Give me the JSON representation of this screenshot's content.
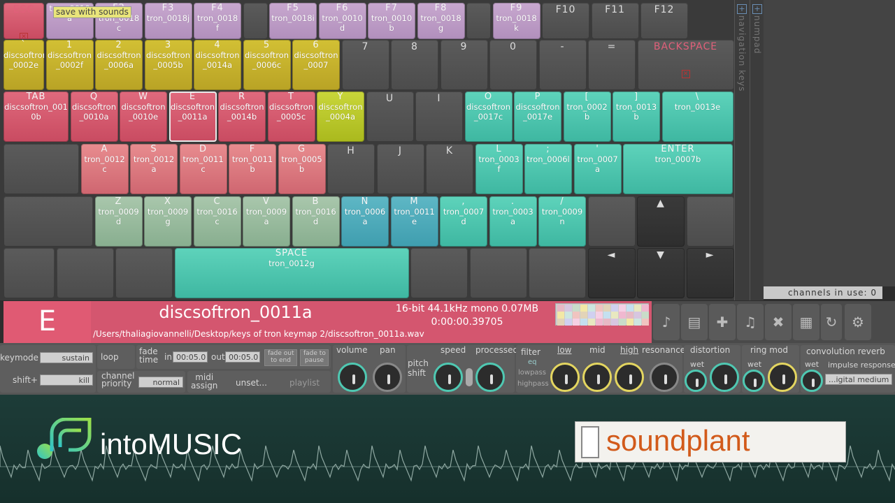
{
  "tooltip": "save with sounds",
  "keyboard": {
    "rows": [
      [
        {
          "label": "ESC",
          "sound": "",
          "color": "red",
          "esc": true
        },
        {
          "label": "",
          "sound": "tron_0010\na",
          "color": "lav"
        },
        {
          "label": "F2",
          "sound": "tron_0018\nc",
          "color": "lav"
        },
        {
          "label": "F3",
          "sound": "tron_0018j",
          "color": "lav"
        },
        {
          "label": "F4",
          "sound": "tron_0018\nf",
          "color": "lav"
        },
        {
          "label": "",
          "sound": "",
          "color": "grey"
        },
        {
          "label": "F5",
          "sound": "tron_0018i",
          "color": "lav"
        },
        {
          "label": "F6",
          "sound": "tron_0010\nd",
          "color": "lav"
        },
        {
          "label": "F7",
          "sound": "tron_0010\nb",
          "color": "lav"
        },
        {
          "label": "F8",
          "sound": "tron_0018\ng",
          "color": "lav"
        },
        {
          "label": "",
          "sound": "",
          "color": "grey"
        },
        {
          "label": "F9",
          "sound": "tron_0018\nk",
          "color": "lav"
        },
        {
          "label": "F10",
          "sound": "",
          "color": "grey"
        },
        {
          "label": "F11",
          "sound": "",
          "color": "grey"
        },
        {
          "label": "F12",
          "sound": "",
          "color": "grey"
        }
      ],
      [
        {
          "label": "`",
          "sound": "discsoftron\n_0002e",
          "color": "olive"
        },
        {
          "label": "1",
          "sound": "discsoftron\n_0002f",
          "color": "olive"
        },
        {
          "label": "2",
          "sound": "discsoftron\n_0006a",
          "color": "olive"
        },
        {
          "label": "3",
          "sound": "discsoftron\n_0005b",
          "color": "olive"
        },
        {
          "label": "4",
          "sound": "discsoftron\n_0014a",
          "color": "olive"
        },
        {
          "label": "5",
          "sound": "discsoftron\n_0006c",
          "color": "olive"
        },
        {
          "label": "6",
          "sound": "discsoftron\n_0007",
          "color": "olive"
        },
        {
          "label": "7",
          "sound": "",
          "color": "grey"
        },
        {
          "label": "8",
          "sound": "",
          "color": "grey"
        },
        {
          "label": "9",
          "sound": "",
          "color": "grey"
        },
        {
          "label": "0",
          "sound": "",
          "color": "grey"
        },
        {
          "label": "-",
          "sound": "",
          "color": "grey"
        },
        {
          "label": "=",
          "sound": "",
          "color": "grey"
        },
        {
          "label": "BACKSPACE",
          "sound": "",
          "color": "grey",
          "bs": true
        }
      ],
      [
        {
          "label": "TAB",
          "sound": "discsoftron_001\n0b",
          "color": "red"
        },
        {
          "label": "Q",
          "sound": "discsoftron\n_0010a",
          "color": "red"
        },
        {
          "label": "W",
          "sound": "discsoftron\n_0010e",
          "color": "red"
        },
        {
          "label": "E",
          "sound": "discsoftron\n_0011a",
          "color": "red",
          "sel": true
        },
        {
          "label": "R",
          "sound": "discsoftron\n_0014b",
          "color": "red"
        },
        {
          "label": "T",
          "sound": "discsoftron\n_0005c",
          "color": "red"
        },
        {
          "label": "Y",
          "sound": "discsoftron\n_0004a",
          "color": "lime"
        },
        {
          "label": "U",
          "sound": "",
          "color": "grey"
        },
        {
          "label": "I",
          "sound": "",
          "color": "grey"
        },
        {
          "label": "O",
          "sound": "discsoftron\n_0017c",
          "color": "teal"
        },
        {
          "label": "P",
          "sound": "discsoftron\n_0017e",
          "color": "teal"
        },
        {
          "label": "[",
          "sound": "tron_0002\nb",
          "color": "teal"
        },
        {
          "label": "]",
          "sound": "tron_0013\nb",
          "color": "teal"
        },
        {
          "label": "\\",
          "sound": "tron_0013e",
          "color": "teal"
        }
      ],
      [
        {
          "label": "",
          "sound": "",
          "color": "grey"
        },
        {
          "label": "A",
          "sound": "tron_0012\nc",
          "color": "rose"
        },
        {
          "label": "S",
          "sound": "tron_0012\na",
          "color": "rose"
        },
        {
          "label": "D",
          "sound": "tron_0011\nc",
          "color": "rose"
        },
        {
          "label": "F",
          "sound": "tron_0011\nb",
          "color": "rose"
        },
        {
          "label": "G",
          "sound": "tron_0005\nb",
          "color": "rose"
        },
        {
          "label": "H",
          "sound": "",
          "color": "grey"
        },
        {
          "label": "J",
          "sound": "",
          "color": "grey"
        },
        {
          "label": "K",
          "sound": "",
          "color": "grey"
        },
        {
          "label": "L",
          "sound": "tron_0003\nf",
          "color": "teal"
        },
        {
          "label": ";",
          "sound": "tron_0006l",
          "color": "teal"
        },
        {
          "label": "'",
          "sound": "tron_0007\na",
          "color": "teal"
        },
        {
          "label": "ENTER",
          "sound": "tron_0007b",
          "color": "teal"
        }
      ],
      [
        {
          "label": "",
          "sound": "",
          "color": "grey"
        },
        {
          "label": "Z",
          "sound": "tron_0009\nd",
          "color": "sage"
        },
        {
          "label": "X",
          "sound": "tron_0009\ng",
          "color": "sage"
        },
        {
          "label": "C",
          "sound": "tron_0016\nc",
          "color": "sage"
        },
        {
          "label": "V",
          "sound": "tron_0009\na",
          "color": "sage"
        },
        {
          "label": "B",
          "sound": "tron_0016\nd",
          "color": "sage"
        },
        {
          "label": "N",
          "sound": "tron_0006\na",
          "color": "cyan"
        },
        {
          "label": "M",
          "sound": "tron_0011\ne",
          "color": "cyan"
        },
        {
          "label": ",",
          "sound": "tron_0007\nd",
          "color": "teal"
        },
        {
          "label": ".",
          "sound": "tron_0003\na",
          "color": "teal"
        },
        {
          "label": "/",
          "sound": "tron_0009\nn",
          "color": "teal"
        },
        {
          "label": "",
          "sound": "",
          "color": "grey"
        },
        {
          "label": "▲",
          "sound": "",
          "color": "dark"
        },
        {
          "label": "",
          "sound": "",
          "color": "grey"
        }
      ],
      [
        {
          "label": "",
          "sound": "",
          "color": "grey"
        },
        {
          "label": "",
          "sound": "",
          "color": "grey"
        },
        {
          "label": "",
          "sound": "",
          "color": "grey"
        },
        {
          "label": "SPACE",
          "sound": "tron_0012g",
          "color": "teal"
        },
        {
          "label": "",
          "sound": "",
          "color": "grey"
        },
        {
          "label": "",
          "sound": "",
          "color": "grey"
        },
        {
          "label": "",
          "sound": "",
          "color": "grey"
        },
        {
          "label": "◄",
          "sound": "",
          "color": "dark"
        },
        {
          "label": "▼",
          "sound": "",
          "color": "dark"
        },
        {
          "label": "►",
          "sound": "",
          "color": "dark"
        }
      ]
    ]
  },
  "side": {
    "nav_label": "navigation keys",
    "numpad_label": "numpad",
    "channels": "channels in use:  0"
  },
  "sound": {
    "key": "E",
    "name": "discsoftron_0011a",
    "path": "/Users/thaliagiovannelli/Desktop/keys of tron keymap 2/discsoftron_0011a.wav",
    "format": "16-bit 44.1kHz mono 0.07MB",
    "time": "0:00:00.39705"
  },
  "controls": {
    "keymode": "keymode",
    "keymode_val": "sustain",
    "shift": "shift+",
    "shift_val": "kill",
    "loop": "loop",
    "channel_priority": "channel\npriority",
    "priority_val": "normal",
    "fade_time": "fade\ntime",
    "fade_in": "in",
    "fade_in_val": "00:05.0",
    "fade_out": "out",
    "fade_out_val": "00:05.0",
    "fade_out_to_end": "fade out\nto end",
    "fade_to_pause": "fade to\npause",
    "midi_assign": "midi\nassign",
    "midi_val": "unset...",
    "playlist": "playlist",
    "volume": "volume",
    "pan": "pan",
    "pitch_shift": "pitch\nshift",
    "speed": "speed",
    "processed": "processed",
    "filter": "filter",
    "eq": "eq",
    "lowpass": "lowpass",
    "highpass": "highpass",
    "low": "low",
    "mid": "mid",
    "high": "high",
    "resonance": "resonance",
    "distortion": "distortion",
    "ring_mod": "ring mod",
    "convolution_reverb": "convolution reverb",
    "wet": "wet",
    "impulse_response": "impulse response",
    "impulse_val": "...igital medium"
  },
  "footer": {
    "brand": "intoMUSIC",
    "soundplant": "soundplant"
  },
  "colors": {
    "accent": "#d4566f",
    "teal": "#4fc8b2",
    "olive": "#c9b52c",
    "lavender": "#bf9fc7"
  }
}
